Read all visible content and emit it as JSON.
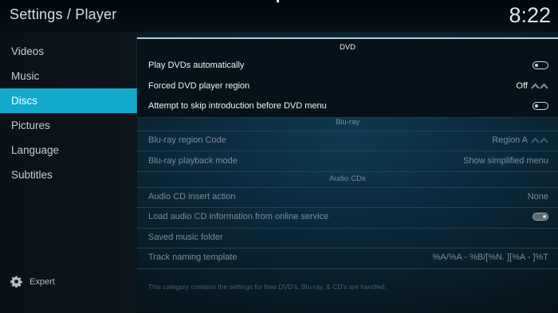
{
  "header": {
    "title": "Settings / Player",
    "clock": "8:22"
  },
  "sidebar": {
    "items": [
      {
        "label": "Videos"
      },
      {
        "label": "Music"
      },
      {
        "label": "Discs"
      },
      {
        "label": "Pictures"
      },
      {
        "label": "Language"
      },
      {
        "label": "Subtitles"
      }
    ],
    "expert_label": "Expert"
  },
  "sections": {
    "dvd": {
      "title": "DVD",
      "play_auto": {
        "label": "Play DVDs automatically",
        "enabled": false
      },
      "region": {
        "label": "Forced DVD player region",
        "value": "Off"
      },
      "skip_intro": {
        "label": "Attempt to skip introduction before DVD menu",
        "enabled": false
      }
    },
    "bluray": {
      "title": "Blu-ray",
      "region": {
        "label": "Blu-ray region Code",
        "value": "Region A"
      },
      "playback": {
        "label": "Blu-ray playback mode",
        "value": "Show simplified menu"
      }
    },
    "audiocd": {
      "title": "Audio CDs",
      "insert": {
        "label": "Audio CD insert action",
        "value": "None"
      },
      "online_info": {
        "label": "Load audio CD information from online service",
        "enabled": true
      },
      "music_folder": {
        "label": "Saved music folder"
      },
      "naming": {
        "label": "Track naming template",
        "value": "%A/%A - %B/[%N. ][%A - ]%T"
      }
    }
  },
  "footer": {
    "description": "This category contains the settings for how DVD's, Blu-ray, & CD's are handled."
  },
  "colors": {
    "accent": "#12a9cc",
    "background": "#0a2433"
  }
}
